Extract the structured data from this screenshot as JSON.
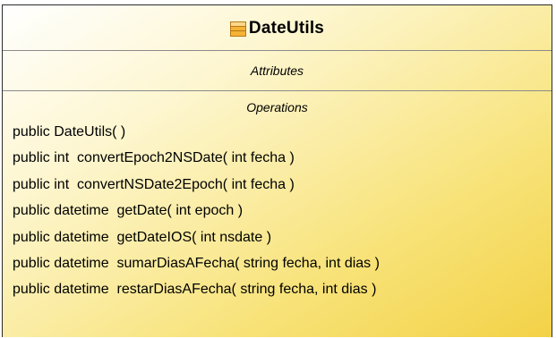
{
  "uml_class": {
    "icon": "class-icon",
    "name": "DateUtils",
    "attributes_title": "Attributes",
    "operations_title": "Operations",
    "operations": [
      "public DateUtils( )",
      "public int  convertEpoch2NSDate( int fecha )",
      "public int  convertNSDate2Epoch( int fecha )",
      "public datetime  getDate( int epoch )",
      "public datetime  getDateIOS( int nsdate )",
      "public datetime  sumarDiasAFecha( string fecha, int dias )",
      "public datetime  restarDiasAFecha( string fecha, int dias )"
    ]
  },
  "colors": {
    "border": "#2b2b2b",
    "divider": "#8a8a8a",
    "fill_light": "#ffffff",
    "fill_dark": "#f3d247",
    "icon_fill": "#f5b335"
  }
}
